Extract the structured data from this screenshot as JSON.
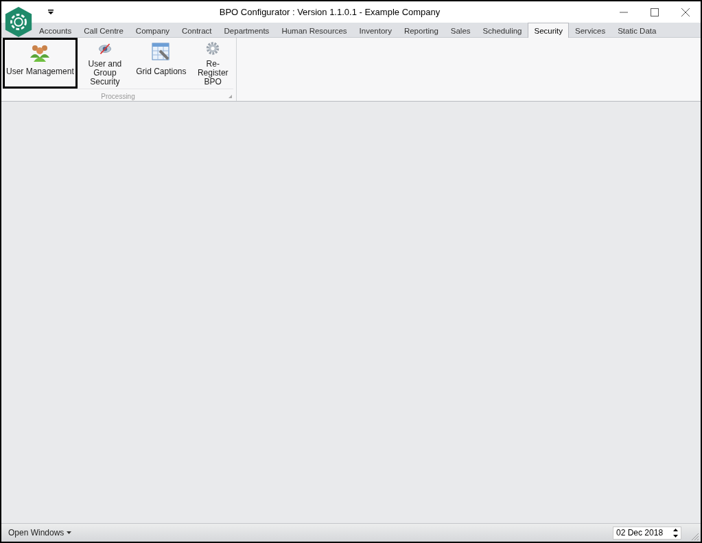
{
  "window": {
    "title": "BPO Configurator : Version 1.1.0.1 - Example Company"
  },
  "tabs": [
    {
      "label": "Accounts",
      "selected": false
    },
    {
      "label": "Call Centre",
      "selected": false
    },
    {
      "label": "Company",
      "selected": false
    },
    {
      "label": "Contract",
      "selected": false
    },
    {
      "label": "Departments",
      "selected": false
    },
    {
      "label": "Human Resources",
      "selected": false
    },
    {
      "label": "Inventory",
      "selected": false
    },
    {
      "label": "Reporting",
      "selected": false
    },
    {
      "label": "Sales",
      "selected": false
    },
    {
      "label": "Scheduling",
      "selected": false
    },
    {
      "label": "Security",
      "selected": true
    },
    {
      "label": "Services",
      "selected": false
    },
    {
      "label": "Static Data",
      "selected": false
    }
  ],
  "ribbon": {
    "group": "Processing",
    "buttons": [
      {
        "label": "User Management",
        "kind": "users",
        "selected": true
      },
      {
        "label": "User and Group Security",
        "kind": "eye",
        "selected": false
      },
      {
        "label": "Grid Captions",
        "kind": "grid",
        "selected": false
      },
      {
        "label": "Re-Register BPO",
        "kind": "gear",
        "selected": false
      }
    ]
  },
  "status_bar": {
    "menu": "Open Windows",
    "date": "02 Dec 2018"
  }
}
